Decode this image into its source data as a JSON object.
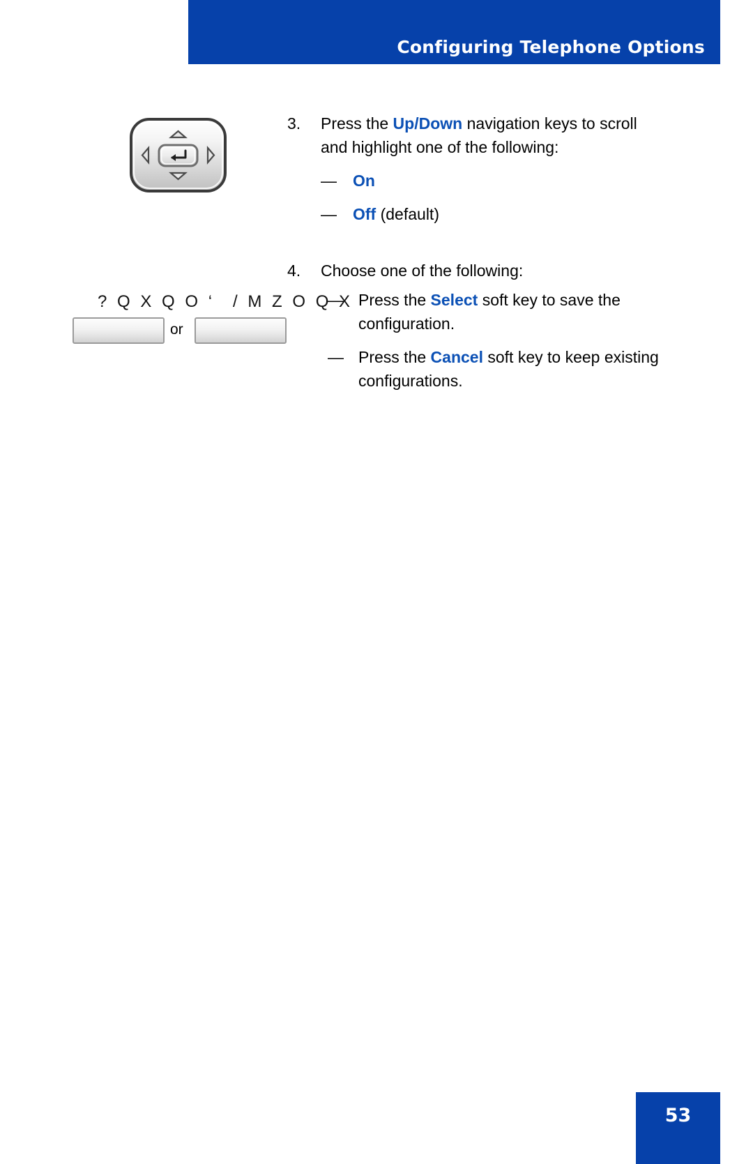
{
  "header": {
    "title": "Configuring Telephone Options",
    "bar_color": "#0641aa",
    "text_color": "#ffffff"
  },
  "page_footer": {
    "page_number": "53",
    "box_color": "#0641aa"
  },
  "accent_color": "#0b50b5",
  "graphics": {
    "navigation_cluster": {
      "name": "navigation-keys-cluster",
      "up_label": "Up",
      "down_label": "Down",
      "left_label": "Left",
      "right_label": "Right",
      "center_label": "Enter"
    },
    "softkey_glyph_left": "? Q X Q O ‘",
    "softkey_glyph_right": "/ M Z O Q X",
    "softkey_or": "or"
  },
  "steps": [
    {
      "number": "3.",
      "text_parts": [
        {
          "t": "Press the ",
          "style": "plain"
        },
        {
          "t": "Up",
          "style": "accent-bold"
        },
        {
          "t": "/",
          "style": "accent-bold"
        },
        {
          "t": "Down",
          "style": "accent-bold"
        },
        {
          "t": " navigation keys to scroll and highlight one of the following:",
          "style": "plain"
        }
      ],
      "full_text": "Press the Up/Down navigation keys to scroll and highlight one of the following:",
      "sub_items": [
        {
          "dash": "—",
          "label": "On",
          "suffix": ""
        },
        {
          "dash": "—",
          "label": "Off",
          "suffix": " (default)"
        }
      ]
    },
    {
      "number": "4.",
      "full_text": "Choose one of the following:",
      "sub_items": [
        {
          "dash": "—",
          "prefix": "Press the ",
          "key": "Select",
          "suffix": " soft key to save the configuration."
        },
        {
          "dash": "—",
          "prefix": "Press the ",
          "key": "Cancel",
          "suffix": " soft key to keep existing configurations."
        }
      ]
    }
  ]
}
